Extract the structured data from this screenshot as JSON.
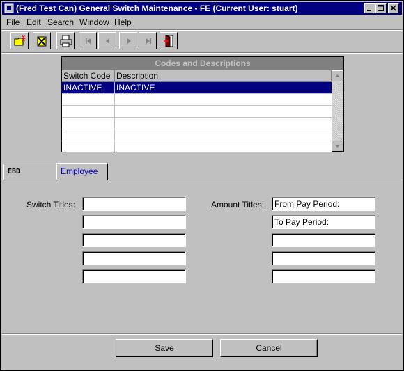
{
  "window": {
    "title": "(Fred Test Can) General Switch Maintenance - FE (Current User: stuart)"
  },
  "menu": [
    "File",
    "Edit",
    "Search",
    "Window",
    "Help"
  ],
  "toolbar": {
    "icons": [
      "new-folder-icon",
      "delete-icon",
      "print-icon",
      "first-record-icon",
      "previous-record-icon",
      "next-record-icon",
      "last-record-icon",
      "exit-door-icon"
    ]
  },
  "grid": {
    "caption": "Codes and Descriptions",
    "columns": [
      "Switch Code",
      "Description"
    ],
    "rows": [
      {
        "code": "INACTIVE",
        "description": "INACTIVE"
      },
      {
        "code": "",
        "description": ""
      },
      {
        "code": "",
        "description": ""
      },
      {
        "code": "",
        "description": ""
      },
      {
        "code": "",
        "description": ""
      },
      {
        "code": "",
        "description": ""
      }
    ]
  },
  "tabs": [
    "EBD",
    "Employee"
  ],
  "form": {
    "switch_titles_label": "Switch Titles:",
    "switch_titles": [
      "",
      "",
      "",
      "",
      ""
    ],
    "amount_titles_label": "Amount Titles:",
    "amount_titles": [
      "From Pay Period:",
      "To Pay Period:",
      "",
      "",
      ""
    ]
  },
  "buttons": {
    "save": "Save",
    "cancel": "Cancel"
  },
  "colors": {
    "titlebar": "#000080",
    "selection": "#000080",
    "face": "#c0c0c0",
    "active_tab_text": "#0000c0"
  }
}
